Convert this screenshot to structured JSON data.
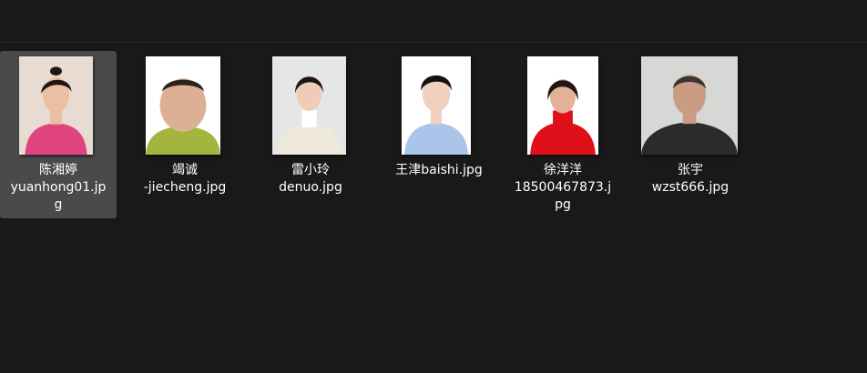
{
  "files": [
    {
      "name": "陈湘婷\nyuanhong01.jp\ng",
      "selected": true,
      "bg": "#e8dcd2",
      "shirt": "#e0457f",
      "skin": "#e9c0a3",
      "hair": "#1d1611"
    },
    {
      "name": "竭诚\n-jiecheng.jpg",
      "selected": false,
      "bg": "#ffffff",
      "shirt": "#a4b53f",
      "skin": "#dcb095",
      "hair": "#2a221d"
    },
    {
      "name": "雷小玲\ndenuo.jpg",
      "selected": false,
      "bg": "#e6e6e6",
      "shirt": "#efe9dc",
      "skin": "#f0ccb6",
      "hair": "#1c1614"
    },
    {
      "name": "王津baishi.jpg",
      "selected": false,
      "bg": "#ffffff",
      "shirt": "#a9c5ea",
      "skin": "#f0d0be",
      "hair": "#161213"
    },
    {
      "name": "徐洋洋\n18500467873.j\npg",
      "selected": false,
      "bg": "#ffffff",
      "shirt": "#e0101b",
      "skin": "#e2b197",
      "hair": "#221813"
    },
    {
      "name": "张宇\nwzst666.jpg",
      "selected": false,
      "bg": "#d7d7d5",
      "shirt": "#2b2b2b",
      "skin": "#c99c83",
      "hair": "#3b352f"
    }
  ]
}
